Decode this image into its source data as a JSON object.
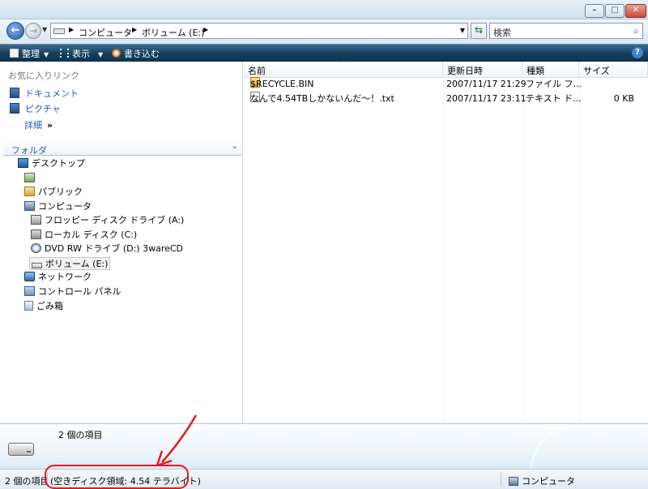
{
  "address": {
    "breadcrumbs": [
      "コンピュータ",
      "ボリューム (E:)"
    ]
  },
  "search": {
    "placeholder": "検索"
  },
  "toolbar": {
    "organize": "整理",
    "views": "表示",
    "burn": "書き込む"
  },
  "favorites": {
    "heading": "お気に入りリンク",
    "items": [
      "ドキュメント",
      "ピクチャ"
    ],
    "more": "詳細"
  },
  "folders": {
    "heading": "フォルダ",
    "tree": [
      {
        "label": "デスクトップ",
        "icon": "desktop-icon"
      },
      {
        "label": "",
        "icon": "user-icon"
      },
      {
        "label": "パブリック",
        "icon": "folder-icon"
      },
      {
        "label": "コンピュータ",
        "icon": "computer-icon"
      },
      {
        "label": "フロッピー ディスク ドライブ (A:)",
        "icon": "floppy-icon"
      },
      {
        "label": "ローカル ディスク (C:)",
        "icon": "local-disk-icon"
      },
      {
        "label": "DVD RW ドライブ (D:) 3wareCD",
        "icon": "dvd-icon"
      },
      {
        "label": "ボリューム (E:)",
        "icon": "drive-icon"
      },
      {
        "label": "ネットワーク",
        "icon": "network-icon"
      },
      {
        "label": "コントロール パネル",
        "icon": "control-panel-icon"
      },
      {
        "label": "ごみ箱",
        "icon": "recycle-bin-icon"
      }
    ]
  },
  "files": {
    "columns": [
      "名前",
      "更新日時",
      "種類",
      "サイズ"
    ],
    "rows": [
      {
        "name": "$RECYCLE.BIN",
        "date": "2007/11/17 21:29",
        "type": "ファイル フ...",
        "size": ""
      },
      {
        "name": "なんで4.54TBしかないんだ～！.txt",
        "date": "2007/11/17 23:11",
        "type": "テキスト ド...",
        "size": "0 KB"
      }
    ]
  },
  "details": {
    "count": "2 個の項目"
  },
  "status": {
    "count": "2 個の項目",
    "free_space": "(空きディスク領域: 4.54 テラバイト)",
    "location": "コンピュータ"
  },
  "colors": {
    "toolbar": "#163e5b",
    "link": "#1d5cc1",
    "annotation": "#e21b1b"
  }
}
